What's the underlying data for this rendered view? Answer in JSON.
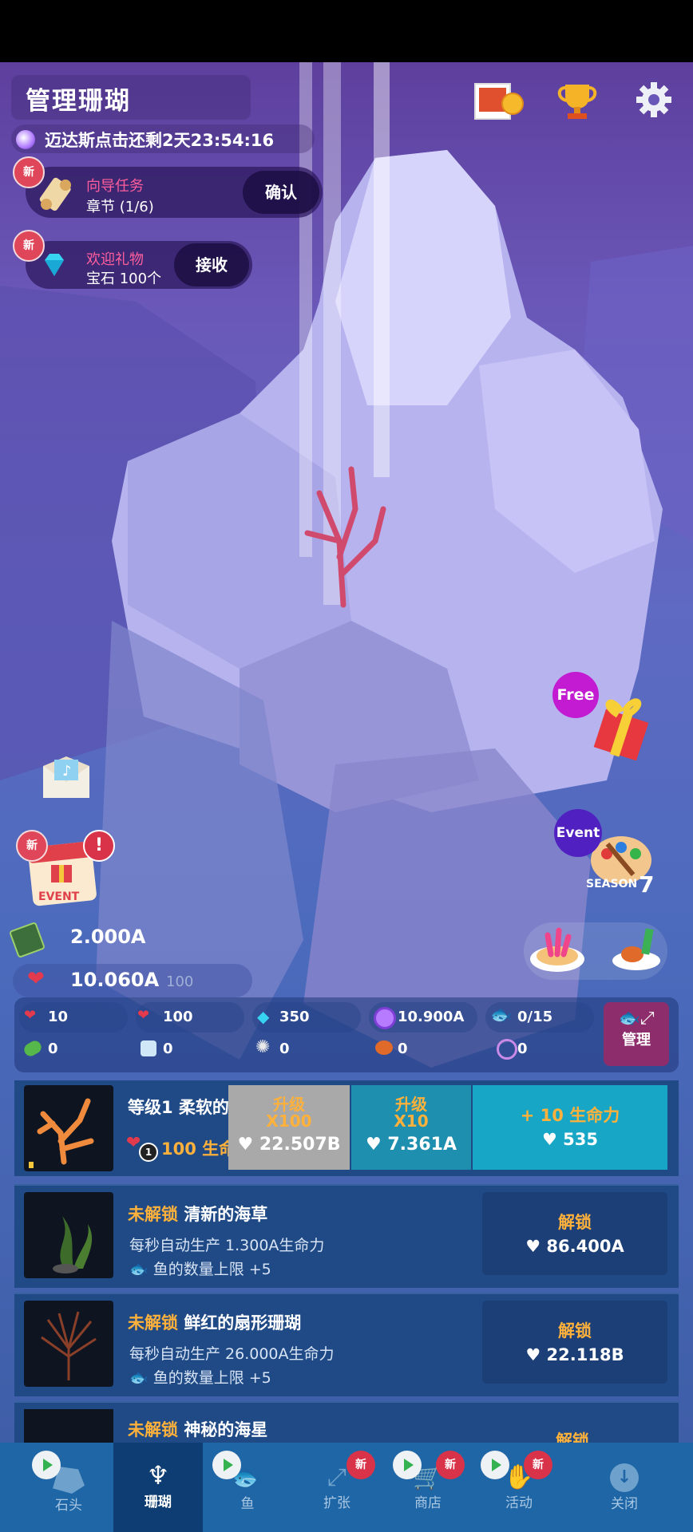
{
  "header": {
    "title": "管理珊瑚",
    "countdown": "迈达斯点击还剩2天23:54:16"
  },
  "quests": {
    "task": {
      "badge": "新",
      "title": "向导任务",
      "subtitle": "章节 (1/6)",
      "button": "确认"
    },
    "gift": {
      "badge": "新",
      "title": "欢迎礼物",
      "subtitle": "宝石 100个",
      "button": "接收"
    }
  },
  "side": {
    "free_label": "Free",
    "event_label": "Event",
    "season_label": "SEASON",
    "season_num": "7",
    "event_badge": "新",
    "event_alert": "!",
    "event_card": "EVENT"
  },
  "stats": {
    "gold": "2.000A",
    "life": "10.060A",
    "life_sub": "100"
  },
  "resources": {
    "row1": [
      "10",
      "100",
      "350",
      "10.900A",
      "0/15"
    ],
    "row2": [
      "0",
      "0",
      "0",
      "0",
      "0"
    ],
    "manage": "管理"
  },
  "coral_upgrade": {
    "name": "等级1 柔软的",
    "cost_label": "100 生命",
    "cost_badge": "1",
    "up100_label": "升级",
    "up100_mult": "X100",
    "up100_cost": "22.507B",
    "up10_label": "升级",
    "up10_mult": "X10",
    "up10_cost": "7.361A",
    "life_label": "+ 10 生命力",
    "life_cost": "535"
  },
  "locked": [
    {
      "lock": "未解锁",
      "name": "清新的海草",
      "prod": "每秒自动生产 1.300A生命力",
      "fish": "鱼的数量上限 +5",
      "btn": "解锁",
      "cost": "86.400A"
    },
    {
      "lock": "未解锁",
      "name": "鲜红的扇形珊瑚",
      "prod": "每秒自动生产 26.000A生命力",
      "fish": "鱼的数量上限 +5",
      "btn": "解锁",
      "cost": "22.118B"
    },
    {
      "lock": "未解锁",
      "name": "神秘的海星",
      "btn": "解锁"
    }
  ],
  "nav": {
    "items": [
      "石头",
      "珊瑚",
      "鱼",
      "扩张",
      "商店",
      "活动",
      "关闭"
    ],
    "badge": "新"
  },
  "colors": {
    "accent_orange": "#ffb13b",
    "quest_pink": "#ff5e9d",
    "badge_red": "#e0465a",
    "nav_blue": "#1f66a6"
  }
}
